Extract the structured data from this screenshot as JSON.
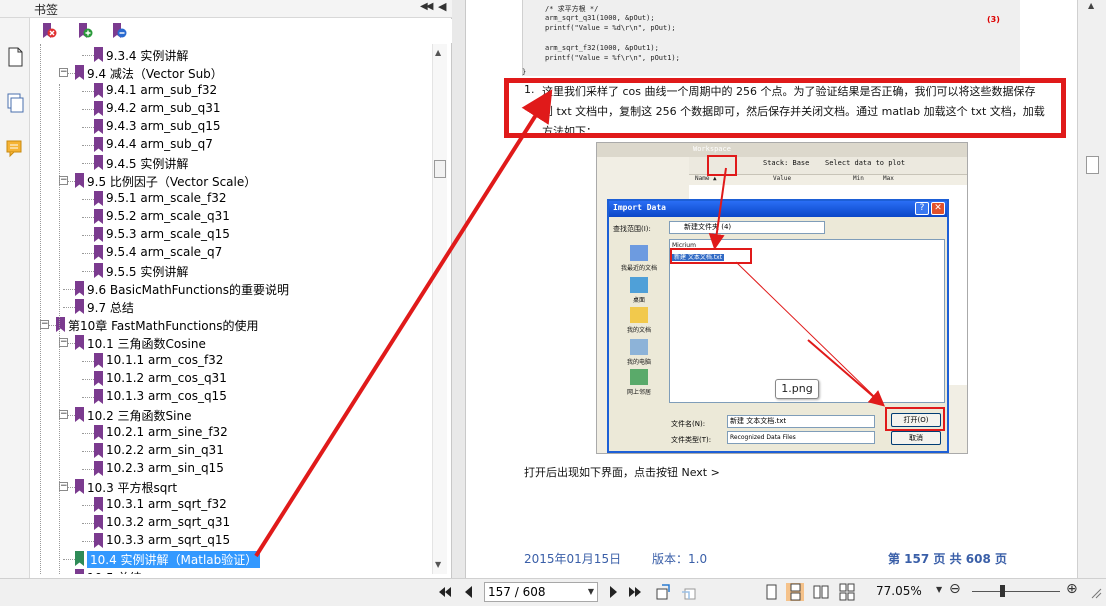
{
  "bookmarks_panel": {
    "title": "书签",
    "collapse_glyph": "◀◀",
    "close_glyph": "◀",
    "toolbar_icons": [
      "delete-bookmark-icon",
      "expand-bookmark-icon",
      "collapse-bookmark-icon"
    ],
    "rail_icons": [
      "page-icon",
      "layers-icon",
      "comments-icon"
    ]
  },
  "tree": [
    {
      "label": "9.3.4 实例讲解",
      "level": 2
    },
    {
      "label": "9.4 减法（Vector Sub）",
      "level": 1,
      "expanded": true
    },
    {
      "label": "9.4.1 arm_sub_f32",
      "level": 2
    },
    {
      "label": "9.4.2 arm_sub_q31",
      "level": 2
    },
    {
      "label": "9.4.3 arm_sub_q15",
      "level": 2
    },
    {
      "label": "9.4.4 arm_sub_q7",
      "level": 2
    },
    {
      "label": "9.4.5 实例讲解",
      "level": 2
    },
    {
      "label": "9.5 比例因子（Vector Scale）",
      "level": 1,
      "expanded": true
    },
    {
      "label": "9.5.1 arm_scale_f32",
      "level": 2
    },
    {
      "label": "9.5.2 arm_scale_q31",
      "level": 2
    },
    {
      "label": "9.5.3 arm_scale_q15",
      "level": 2
    },
    {
      "label": "9.5.4 arm_scale_q7",
      "level": 2
    },
    {
      "label": "9.5.5 实例讲解",
      "level": 2
    },
    {
      "label": "9.6 BasicMathFunctions的重要说明",
      "level": 1
    },
    {
      "label": "9.7 总结",
      "level": 1
    },
    {
      "label": "第10章 FastMathFunctions的使用",
      "level": 0,
      "expanded": true
    },
    {
      "label": "10.1 三角函数Cosine",
      "level": 1,
      "expanded": true
    },
    {
      "label": "10.1.1 arm_cos_f32",
      "level": 2
    },
    {
      "label": "10.1.2 arm_cos_q31",
      "level": 2
    },
    {
      "label": "10.1.3 arm_cos_q15",
      "level": 2
    },
    {
      "label": "10.2 三角函数Sine",
      "level": 1,
      "expanded": true
    },
    {
      "label": "10.2.1 arm_sine_f32",
      "level": 2
    },
    {
      "label": "10.2.2 arm_sin_q31",
      "level": 2
    },
    {
      "label": "10.2.3 arm_sin_q15",
      "level": 2
    },
    {
      "label": "10.3 平方根sqrt",
      "level": 1,
      "expanded": true
    },
    {
      "label": "10.3.1 arm_sqrt_f32",
      "level": 2
    },
    {
      "label": "10.3.2 arm_sqrt_q31",
      "level": 2
    },
    {
      "label": "10.3.3 arm_sqrt_q15",
      "level": 2
    },
    {
      "label": "10.4 实例讲解（Matlab验证）",
      "level": 1,
      "selected": true
    },
    {
      "label": "10.5 总结",
      "level": 1
    }
  ],
  "document": {
    "code_lines": [
      "/* 求平方根 */",
      "arm_sqrt_q31(1000, &pOut);",
      "printf(\"Value = %d\\r\\n\", pOut);",
      "",
      "arm_sqrt_f32(1000, &pOut1);",
      "printf(\"Value = %f\\r\\n\", pOut1);"
    ],
    "code_closing": "}",
    "code_marker": "(3)",
    "para_number": "1.",
    "para_lines": [
      "这里我们采样了 cos 曲线一个周期中的 256 个点。为了验证结果是否正确，我们可以将这些数据保存",
      "到 txt 文档中，复制这 256 个数据即可，然后保存并关闭文档。通过 matlab 加载这个 txt 文档，加载",
      "方法如下："
    ],
    "matlab": {
      "workspace_title": "Workspace",
      "toolbar_stack": "Stack: Base",
      "toolbar_select": "Select data to plot",
      "columns": [
        "Name ▲",
        "Value",
        "Min",
        "Max"
      ],
      "dialog_title": "Import Data",
      "look_in_label": "查找范围(I):",
      "look_in_value": "新建文件夹 (4)",
      "places": [
        "我最近的文档",
        "桌面",
        "我的文档",
        "我的电脑",
        "网上邻居"
      ],
      "files": [
        "Micrium",
        "新建 文本文档.txt"
      ],
      "filename_label": "文件名(N):",
      "filename_value": "新建 文本文档.txt",
      "filetype_label": "文件类型(T):",
      "filetype_value": "Recognized Data Files",
      "open_button": "打开(O)",
      "cancel_button": "取消"
    },
    "callout_label": "1.png",
    "after_text": "打开后出现如下界面，点击按钮 Next >",
    "footer_date": "2015年01月15日",
    "footer_version": "版本：1.0",
    "footer_page": "第 157 页  共 608 页"
  },
  "status_bar": {
    "page_value": "157 / 608",
    "zoom_value": "77.05%",
    "nav_icons": [
      "first-page-icon",
      "prev-page-icon",
      "next-page-icon",
      "last-page-icon",
      "previous-view-icon",
      "next-view-icon"
    ],
    "view_icons": [
      "single-page-icon",
      "continuous-page-icon",
      "facing-pages-icon",
      "continuous-facing-icon"
    ],
    "zoom_out_glyph": "⊖",
    "zoom_in_glyph": "⊕"
  },
  "colors": {
    "annotation_red": "#e01a1a",
    "bookmark_purple": "#7b3b8f",
    "selection_blue": "#3399ff",
    "footer_blue": "#3a5fa8"
  }
}
